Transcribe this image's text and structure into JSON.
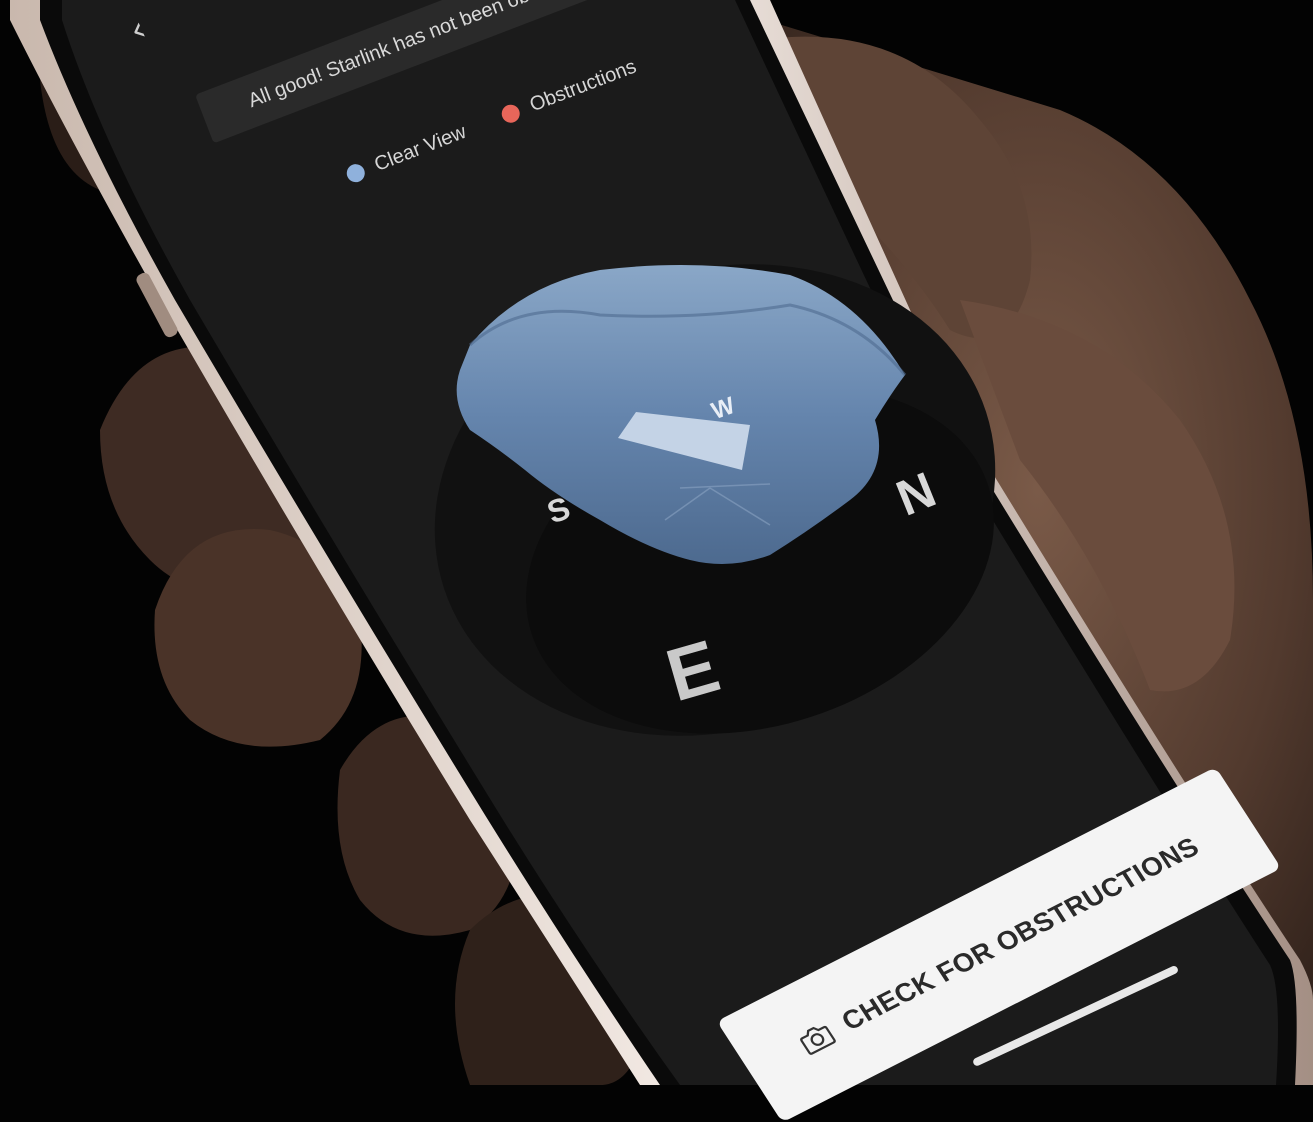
{
  "nav": {
    "back_glyph": "‹"
  },
  "status": {
    "message": "All good! Starlink has not been obstructed recently"
  },
  "legend": {
    "items": [
      {
        "label": "Clear View",
        "color": "#8fb1dc"
      },
      {
        "label": "Obstructions",
        "color": "#e8665a"
      }
    ]
  },
  "compass": {
    "north": "N",
    "south": "S",
    "east": "E",
    "west": "W"
  },
  "action": {
    "label": "CHECK FOR OBSTRUCTIONS",
    "icon": "camera-icon"
  },
  "colors": {
    "screen_bg": "#1b1b1b",
    "sky": "#6e8fb6",
    "button_bg": "#f4f4f4"
  }
}
